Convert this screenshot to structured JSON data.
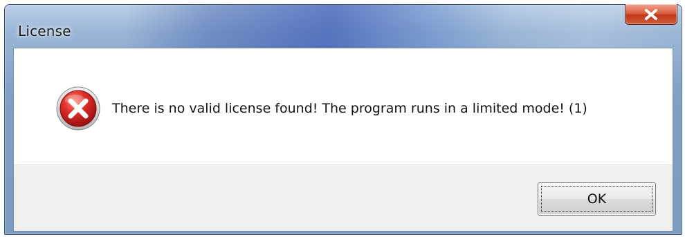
{
  "window": {
    "title": "License",
    "close_label": "close"
  },
  "dialog": {
    "icon": "error-icon",
    "message": "There is no valid license found! The program runs in a limited mode! (1)"
  },
  "buttons": {
    "ok_label": "OK"
  },
  "colors": {
    "error_red": "#c8102e",
    "close_button": "#c1371a",
    "button_area": "#f0f0f0"
  }
}
